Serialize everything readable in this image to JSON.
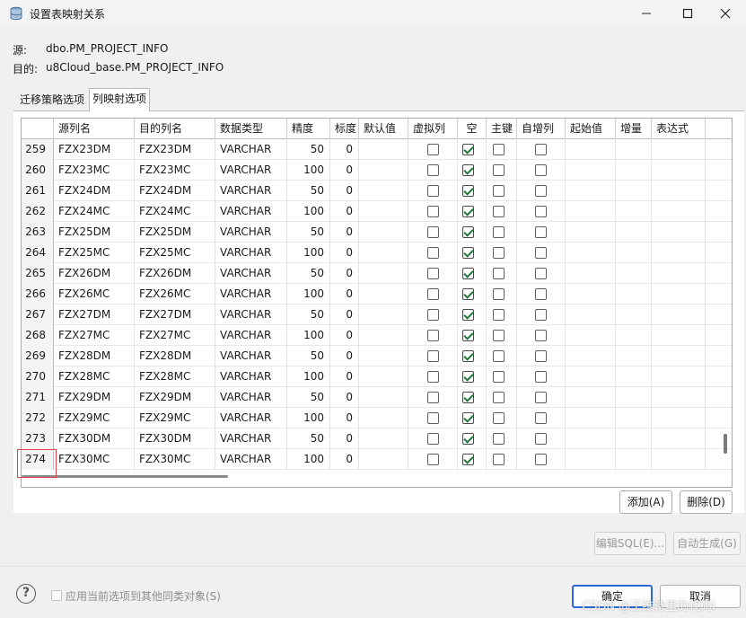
{
  "window": {
    "title": "设置表映射关系"
  },
  "info": {
    "source_label": "源:",
    "source_value": "dbo.PM_PROJECT_INFO",
    "target_label": "目的:",
    "target_value": "u8Cloud_base.PM_PROJECT_INFO"
  },
  "tabs": [
    {
      "label": "迁移策略选项",
      "active": false
    },
    {
      "label": "列映射选项",
      "active": true
    }
  ],
  "table": {
    "columns": [
      "",
      "源列名",
      "目的列名",
      "数据类型",
      "精度",
      "标度",
      "默认值",
      "虚拟列",
      "空",
      "主键",
      "自增列",
      "起始值",
      "增量",
      "表达式"
    ],
    "rows": [
      {
        "num": "259",
        "src": "FZX23DM",
        "dst": "FZX23DM",
        "type": "VARCHAR",
        "precision": "50",
        "scale": "0",
        "nullable": true
      },
      {
        "num": "260",
        "src": "FZX23MC",
        "dst": "FZX23MC",
        "type": "VARCHAR",
        "precision": "100",
        "scale": "0",
        "nullable": true
      },
      {
        "num": "261",
        "src": "FZX24DM",
        "dst": "FZX24DM",
        "type": "VARCHAR",
        "precision": "50",
        "scale": "0",
        "nullable": true
      },
      {
        "num": "262",
        "src": "FZX24MC",
        "dst": "FZX24MC",
        "type": "VARCHAR",
        "precision": "100",
        "scale": "0",
        "nullable": true
      },
      {
        "num": "263",
        "src": "FZX25DM",
        "dst": "FZX25DM",
        "type": "VARCHAR",
        "precision": "50",
        "scale": "0",
        "nullable": true
      },
      {
        "num": "264",
        "src": "FZX25MC",
        "dst": "FZX25MC",
        "type": "VARCHAR",
        "precision": "100",
        "scale": "0",
        "nullable": true
      },
      {
        "num": "265",
        "src": "FZX26DM",
        "dst": "FZX26DM",
        "type": "VARCHAR",
        "precision": "50",
        "scale": "0",
        "nullable": true
      },
      {
        "num": "266",
        "src": "FZX26MC",
        "dst": "FZX26MC",
        "type": "VARCHAR",
        "precision": "100",
        "scale": "0",
        "nullable": true
      },
      {
        "num": "267",
        "src": "FZX27DM",
        "dst": "FZX27DM",
        "type": "VARCHAR",
        "precision": "50",
        "scale": "0",
        "nullable": true
      },
      {
        "num": "268",
        "src": "FZX27MC",
        "dst": "FZX27MC",
        "type": "VARCHAR",
        "precision": "100",
        "scale": "0",
        "nullable": true
      },
      {
        "num": "269",
        "src": "FZX28DM",
        "dst": "FZX28DM",
        "type": "VARCHAR",
        "precision": "50",
        "scale": "0",
        "nullable": true
      },
      {
        "num": "270",
        "src": "FZX28MC",
        "dst": "FZX28MC",
        "type": "VARCHAR",
        "precision": "100",
        "scale": "0",
        "nullable": true
      },
      {
        "num": "271",
        "src": "FZX29DM",
        "dst": "FZX29DM",
        "type": "VARCHAR",
        "precision": "50",
        "scale": "0",
        "nullable": true
      },
      {
        "num": "272",
        "src": "FZX29MC",
        "dst": "FZX29MC",
        "type": "VARCHAR",
        "precision": "100",
        "scale": "0",
        "nullable": true
      },
      {
        "num": "273",
        "src": "FZX30DM",
        "dst": "FZX30DM",
        "type": "VARCHAR",
        "precision": "50",
        "scale": "0",
        "nullable": true
      },
      {
        "num": "274",
        "src": "FZX30MC",
        "dst": "FZX30MC",
        "type": "VARCHAR",
        "precision": "100",
        "scale": "0",
        "nullable": true
      }
    ]
  },
  "buttons": {
    "add": "添加(A)",
    "delete": "删除(D)",
    "edit_sql": "编辑SQL(E)...",
    "auto_generate": "自动生成(G)",
    "ok": "确定",
    "cancel": "取消"
  },
  "footer": {
    "apply_label": "应用当前选项到其他同类对象(S)",
    "watermark": "CSDN @王维诗里的代码i"
  },
  "colors": {
    "check": "#1f7a3a",
    "highlight_border": "#e0434b",
    "primary_border": "#2d6ad7"
  }
}
